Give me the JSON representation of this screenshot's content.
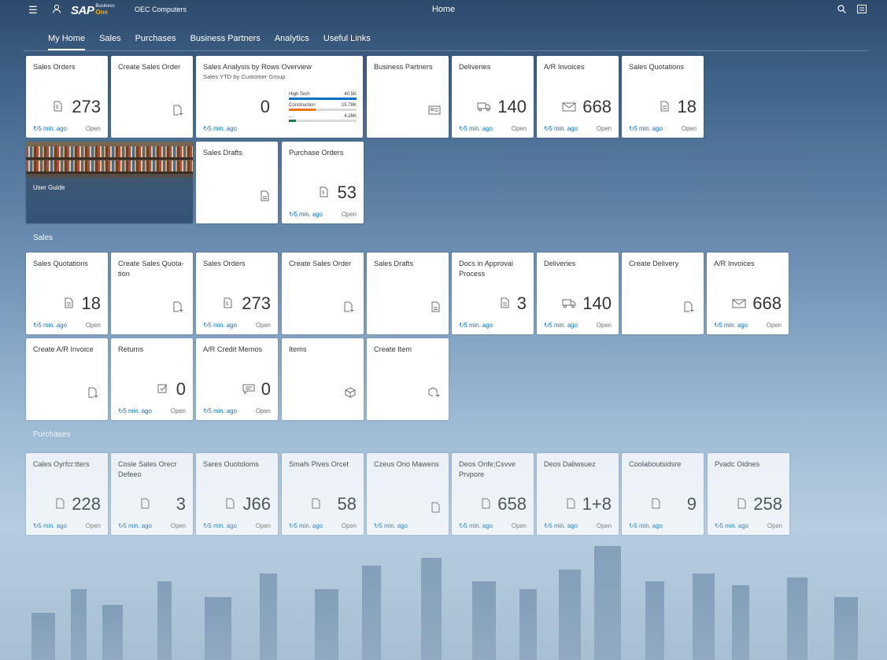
{
  "header": {
    "logo_text": "SAP",
    "logo_sub1": "Business",
    "logo_sub2": "One",
    "company": "OEC Computers",
    "title": "Home"
  },
  "tabs": [
    {
      "label": "My Home",
      "active": true
    },
    {
      "label": "Sales"
    },
    {
      "label": "Purchases"
    },
    {
      "label": "Business Partners"
    },
    {
      "label": "Analytics"
    },
    {
      "label": "Useful Links"
    }
  ],
  "common": {
    "ago": "5 min. ago",
    "open": "Open"
  },
  "myhome": {
    "sales_orders": {
      "title": "Sales Orders",
      "value": "273"
    },
    "create_sales_order": {
      "title": "Create Sales Order"
    },
    "sales_analysis": {
      "title": "Sales Analysis by Rows Overview",
      "subtitle": "Sales YTD by Customer Group",
      "value": "0",
      "bars": [
        {
          "label": "High Tech",
          "value": "40.5K",
          "fraction": 1.0,
          "color": "#0a6ed1"
        },
        {
          "label": "Construction",
          "value": "15.78K",
          "fraction": 0.39,
          "color": "#e9730c"
        },
        {
          "label": "...",
          "value": "4.26K",
          "fraction": 0.11,
          "color": "#107e3e"
        }
      ]
    },
    "business_partners": {
      "title": "Business Partners"
    },
    "deliveries": {
      "title": "Deliveries",
      "value": "140"
    },
    "ar_invoices": {
      "title": "A/R Invoices",
      "value": "668"
    },
    "sales_quotations": {
      "title": "Sales Quotations",
      "value": "18"
    },
    "user_guide": {
      "title": "User Guide"
    },
    "sales_drafts": {
      "title": "Sales Drafts"
    },
    "purchase_orders": {
      "title": "Purchase Orders",
      "value": "53"
    }
  },
  "sales_section": {
    "heading": "Sales",
    "tiles": {
      "sales_quotations": {
        "title": "Sales Quotations",
        "value": "18"
      },
      "create_sales_quotation": {
        "title": "Create Sales Quota-tion"
      },
      "sales_orders": {
        "title": "Sales Orders",
        "value": "273"
      },
      "create_sales_order": {
        "title": "Create Sales Order"
      },
      "sales_drafts": {
        "title": "Sales Drafts"
      },
      "docs_approval": {
        "title": "Docs in Approval Process",
        "value": "3"
      },
      "deliveries": {
        "title": "Deliveries",
        "value": "140"
      },
      "create_delivery": {
        "title": "Create Delivery"
      },
      "ar_invoices": {
        "title": "A/R Invoices",
        "value": "668"
      },
      "create_ar_invoice": {
        "title": "Create A/R Invoice"
      },
      "returns": {
        "title": "Returns",
        "value": "0"
      },
      "ar_credit_memos": {
        "title": "A/R Credit Memos",
        "value": "0"
      },
      "items": {
        "title": "Items"
      },
      "create_item": {
        "title": "Create Item"
      }
    }
  },
  "purchases_section": {
    "heading": "Purchases",
    "tiles": [
      {
        "title": "Cales Oyrfcr:tters",
        "value": "228"
      },
      {
        "title": "Cosie Sales Orecr Defeeo",
        "value": "3"
      },
      {
        "title": "Sares Ouotoloms",
        "value": "J66"
      },
      {
        "title": "Smafs Pives Orcet",
        "value": "58"
      },
      {
        "title": "Czeus Ono Mawens",
        "value": ""
      },
      {
        "title": "Deos Onfe;Csvve Prvpore",
        "value": "658"
      },
      {
        "title": "Deos Daliwsuez",
        "value": "1+8"
      },
      {
        "title": "Coolaboutsidsre",
        "value": "9"
      },
      {
        "title": "Pvadc Oidnes",
        "value": "258"
      }
    ]
  },
  "colors": {
    "accent": "#0a6ed1",
    "tile_bg": "#ffffff"
  }
}
